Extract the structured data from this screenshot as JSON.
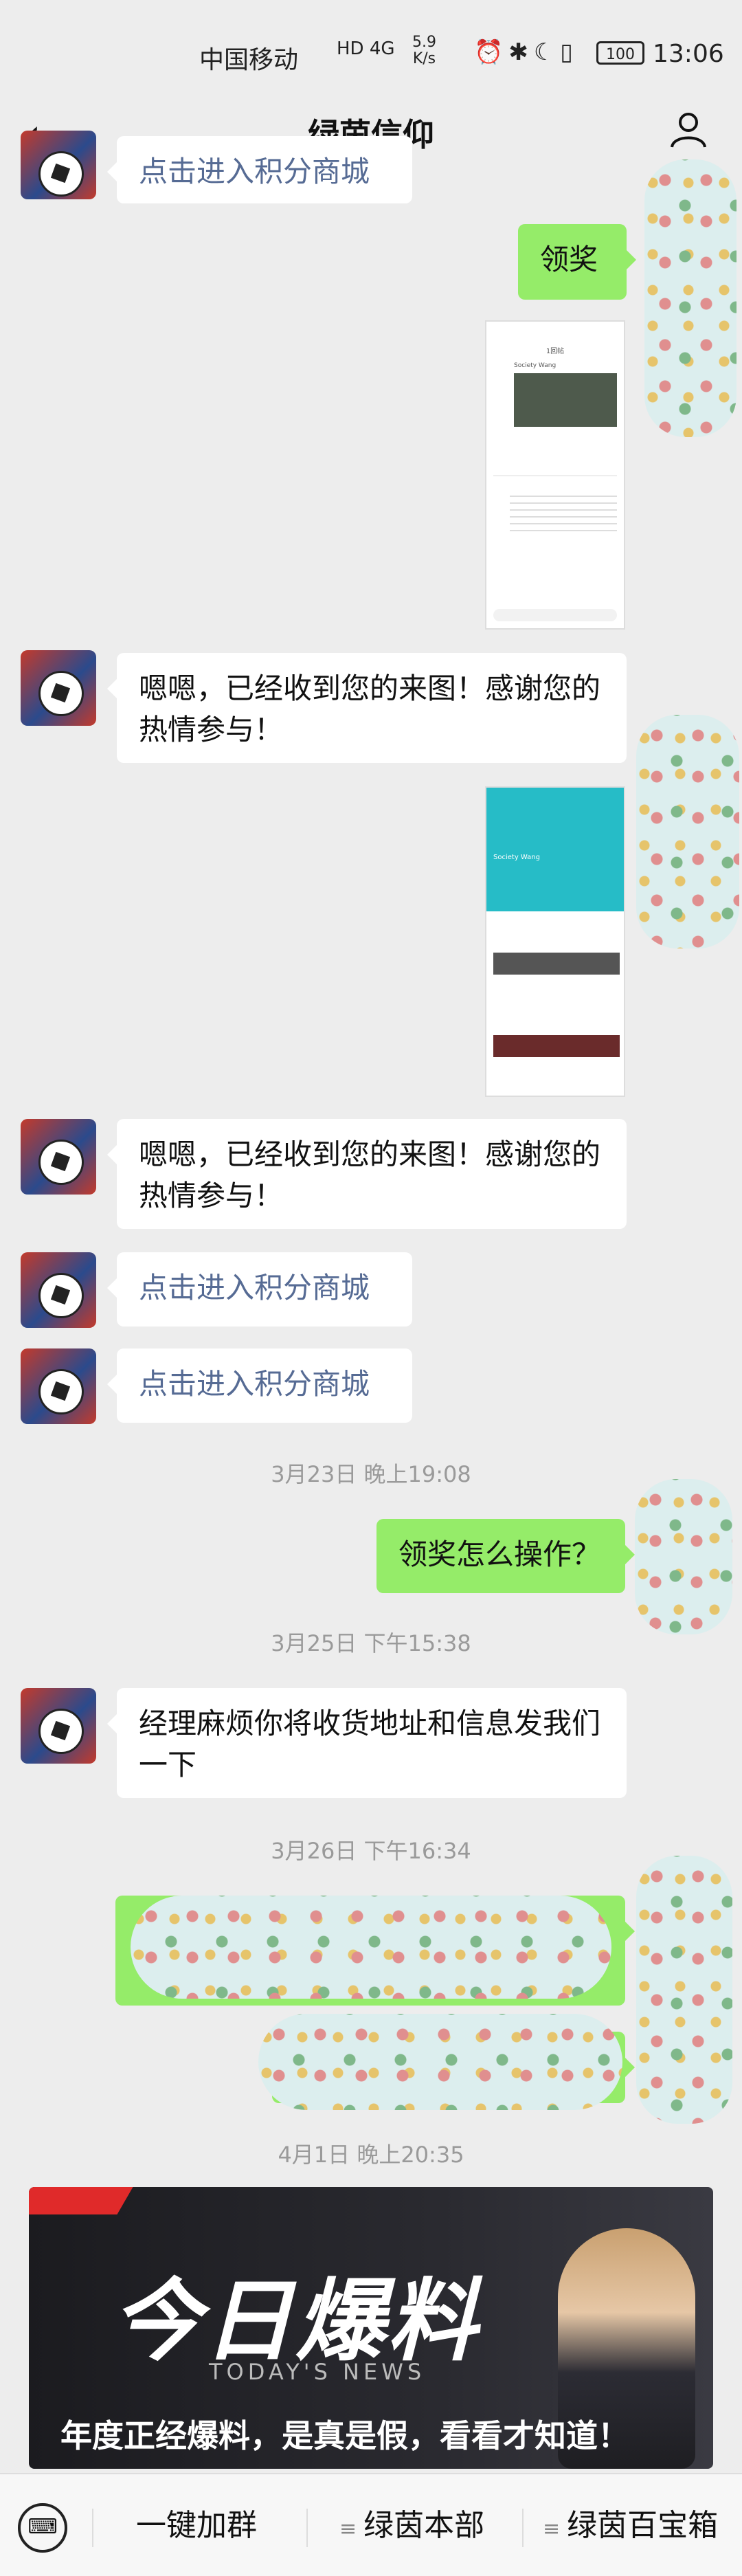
{
  "status_bar": {
    "carrier": "中国移动",
    "network": "HD 4G",
    "speed_value": "5.9",
    "speed_unit": "K/s",
    "battery": "100",
    "time": "13:06"
  },
  "nav": {
    "title": "绿茵信仰",
    "back_icon": "chevron-left-icon",
    "profile_icon": "person-icon"
  },
  "messages": {
    "top_partial_link": "点击进入积分商城",
    "m1_green": "领奖",
    "m3_text": "嗯嗯，已经收到您的来图！感谢您的热情参与！",
    "m5_text": "嗯嗯，已经收到您的来图！感谢您的热情参与！",
    "m6_link": "点击进入积分商城",
    "m7_link": "点击进入积分商城",
    "ts1": "3月23日 晚上19:08",
    "m8_green": "领奖怎么操作？",
    "ts2": "3月25日 下午15:38",
    "m9_text": "经理麻烦你将收货地址和信息发我们一下",
    "ts3": "3月26日 下午16:34",
    "ts4": "4月1日 晚上20:35"
  },
  "screenshot1": {
    "title": "1回帖",
    "user": "Society Wang"
  },
  "screenshot2": {
    "user": "Society Wang"
  },
  "news_card": {
    "headline": "今日爆料",
    "subtitle": "TODAY'S NEWS",
    "tagline": "年度正经爆料，是真是假，看看才知道！"
  },
  "bottom_menu": {
    "keyboard_icon": "keyboard-icon",
    "item1": "一键加群",
    "item2": "绿茵本部",
    "item3": "绿茵百宝箱"
  }
}
